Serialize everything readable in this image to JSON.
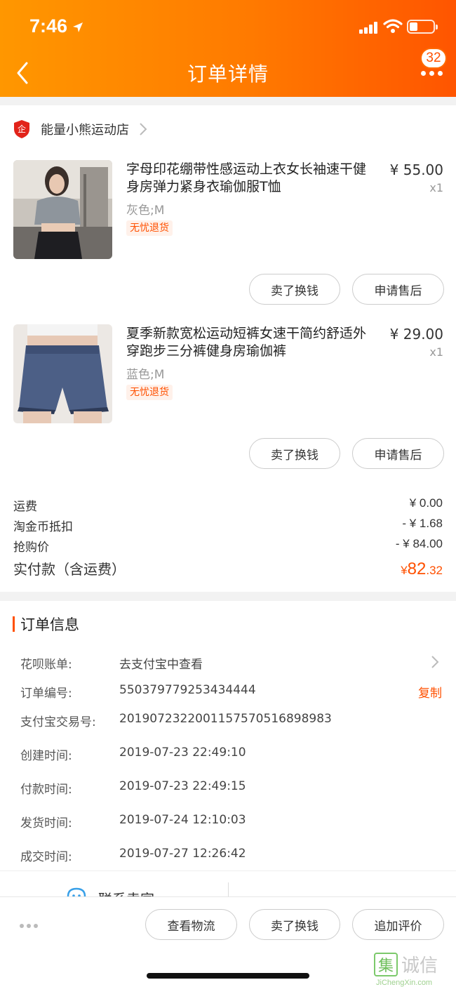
{
  "status_bar": {
    "time": "7:46"
  },
  "nav": {
    "title": "订单详情",
    "badge_count": "32"
  },
  "store": {
    "name": "能量小熊运动店"
  },
  "products": [
    {
      "title": "字母印花绷带性感运动上衣女长袖速干健身房弹力紧身衣瑜伽服T恤",
      "sku": "灰色;M",
      "tag": "无忧退货",
      "price": "¥ 55.00",
      "qty": "x1",
      "btn_sell": "卖了换钱",
      "btn_aftersale": "申请售后"
    },
    {
      "title": "夏季新款宽松运动短裤女速干简约舒适外穿跑步三分裤健身房瑜伽裤",
      "sku": "蓝色;M",
      "tag": "无忧退货",
      "price": "¥ 29.00",
      "qty": "x1",
      "btn_sell": "卖了换钱",
      "btn_aftersale": "申请售后"
    }
  ],
  "summary": {
    "shipping_label": "运费",
    "shipping_value": "¥ 0.00",
    "coin_label": "淘金币抵扣",
    "coin_value": "- ¥ 1.68",
    "flash_label": "抢购价",
    "flash_value": "- ¥ 84.00",
    "total_label": "实付款（含运费）",
    "total_currency": "¥",
    "total_int": "82",
    "total_dec": ".32"
  },
  "order_info": {
    "title": "订单信息",
    "rows": [
      {
        "label": "花呗账单:",
        "value": "去支付宝中查看"
      },
      {
        "label": "订单编号:",
        "value": "550379779253434444",
        "action": "复制"
      },
      {
        "label": "支付宝交易号:",
        "value": "2019072322001157570516898983"
      },
      {
        "label": "创建时间:",
        "value": "2019-07-23 22:49:10"
      },
      {
        "label": "付款时间:",
        "value": "2019-07-23 22:49:15"
      },
      {
        "label": "发货时间:",
        "value": "2019-07-24 12:10:03"
      },
      {
        "label": "成交时间:",
        "value": "2019-07-27 12:26:42"
      }
    ]
  },
  "contact": {
    "label": "联系卖家"
  },
  "bottom_bar": {
    "btn_logistics": "查看物流",
    "btn_sell": "卖了换钱",
    "btn_review": "追加评价"
  },
  "watermark": {
    "line1": "集诚信",
    "line2": "JiChengXin.com"
  },
  "colors": {
    "accent": "#ff5000",
    "header_start": "#ff9700",
    "header_end": "#ff5500"
  },
  "icons": [
    "location-arrow-icon",
    "signal-icon",
    "wifi-icon",
    "battery-icon",
    "back-arrow-icon",
    "more-icon",
    "store-shield-icon",
    "chevron-right-icon",
    "chat-icon"
  ]
}
